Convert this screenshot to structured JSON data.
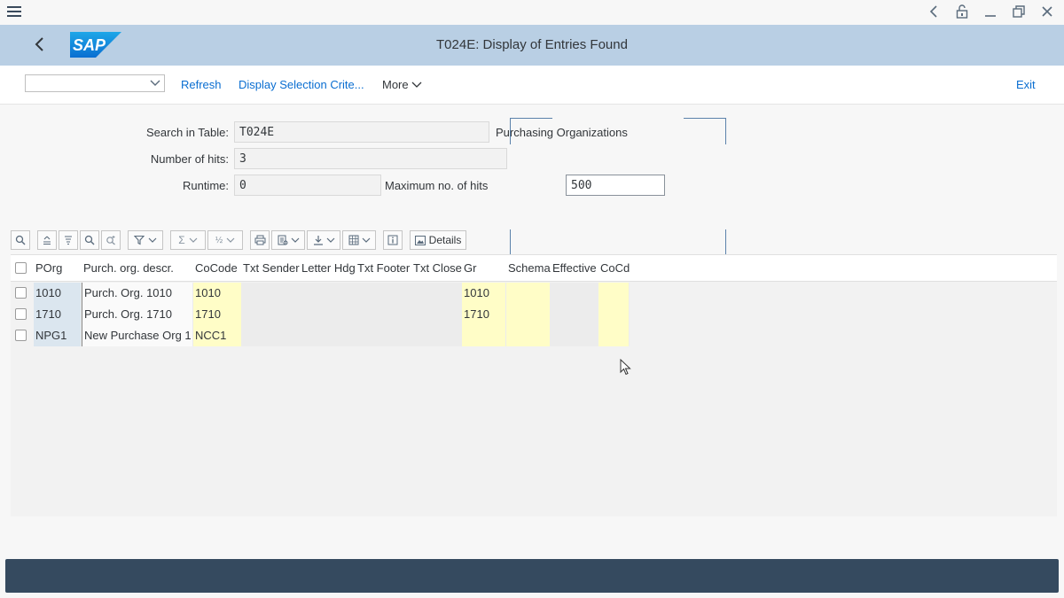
{
  "window": {
    "title": "T024E: Display of Entries Found",
    "logo_text": "SAP"
  },
  "toolbar": {
    "dropdown_value": "",
    "refresh_label": "Refresh",
    "display_selection_label": "Display Selection Crite...",
    "more_label": "More",
    "exit_label": "Exit"
  },
  "form": {
    "search_label": "Search in Table:",
    "search_value": "T024E",
    "search_desc": "Purchasing Organizations",
    "hits_label": "Number of hits:",
    "hits_value": "3",
    "runtime_label": "Runtime:",
    "runtime_value": "0",
    "max_hits_label": "Maximum no. of hits",
    "max_hits_value": "500"
  },
  "alv": {
    "details_label": "Details"
  },
  "table": {
    "columns": [
      "POrg",
      "Purch. org. descr.",
      "CoCode",
      "Txt Sender",
      "Letter Hdg",
      "Txt Footer",
      "Txt Close",
      "Gr",
      "Schema",
      "Effective",
      "CoCd"
    ],
    "rows": [
      [
        "1010",
        "Purch. Org. 1010",
        "1010",
        "",
        "",
        "",
        "",
        "1010",
        "",
        "",
        ""
      ],
      [
        "1710",
        "Purch. Org. 1710",
        "1710",
        "",
        "",
        "",
        "",
        "1710",
        "",
        "",
        ""
      ],
      [
        "NPG1",
        "New Purchase Org 1",
        "NCC1",
        "",
        "",
        "",
        "",
        "",
        "",
        "",
        ""
      ]
    ]
  },
  "colors": {
    "title_bar": "#b9cfe4",
    "status_bar": "#354a5f",
    "link": "#0a6ed1",
    "key_cell": "#dbe6ef",
    "input_cell": "#fffdc7"
  }
}
